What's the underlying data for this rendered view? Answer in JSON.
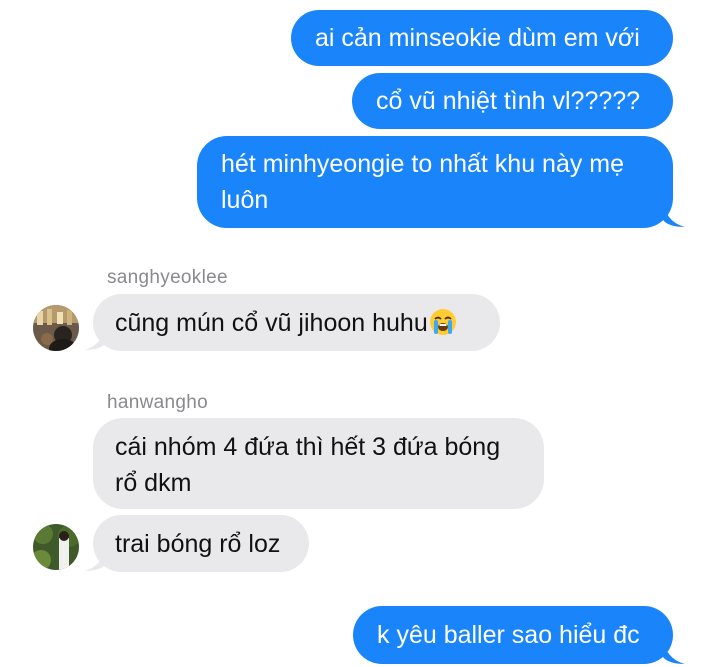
{
  "messages": {
    "sent_1": "ai cản minseokie dùm em với",
    "sent_2": "cổ vũ nhiệt tình vl?????",
    "sent_3": "hét minhyeongie to nhất khu này mẹ luôn",
    "sender_1": "sanghyeoklee",
    "recv_1": "cũng mún cổ vũ jihoon huhu",
    "sender_2": "hanwangho",
    "recv_2": "cái nhóm 4 đứa thì hết 3 đứa bóng rổ dkm",
    "recv_3": "trai bóng rổ loz",
    "sent_4": "k yêu baller sao hiểu đc"
  },
  "icons": {
    "recv_1_emoji": "loudly-crying-face-icon"
  },
  "colors": {
    "sent_bubble": "#1a84fb",
    "recv_bubble": "#e9e9eb",
    "sender_name": "#8a8a8e"
  }
}
